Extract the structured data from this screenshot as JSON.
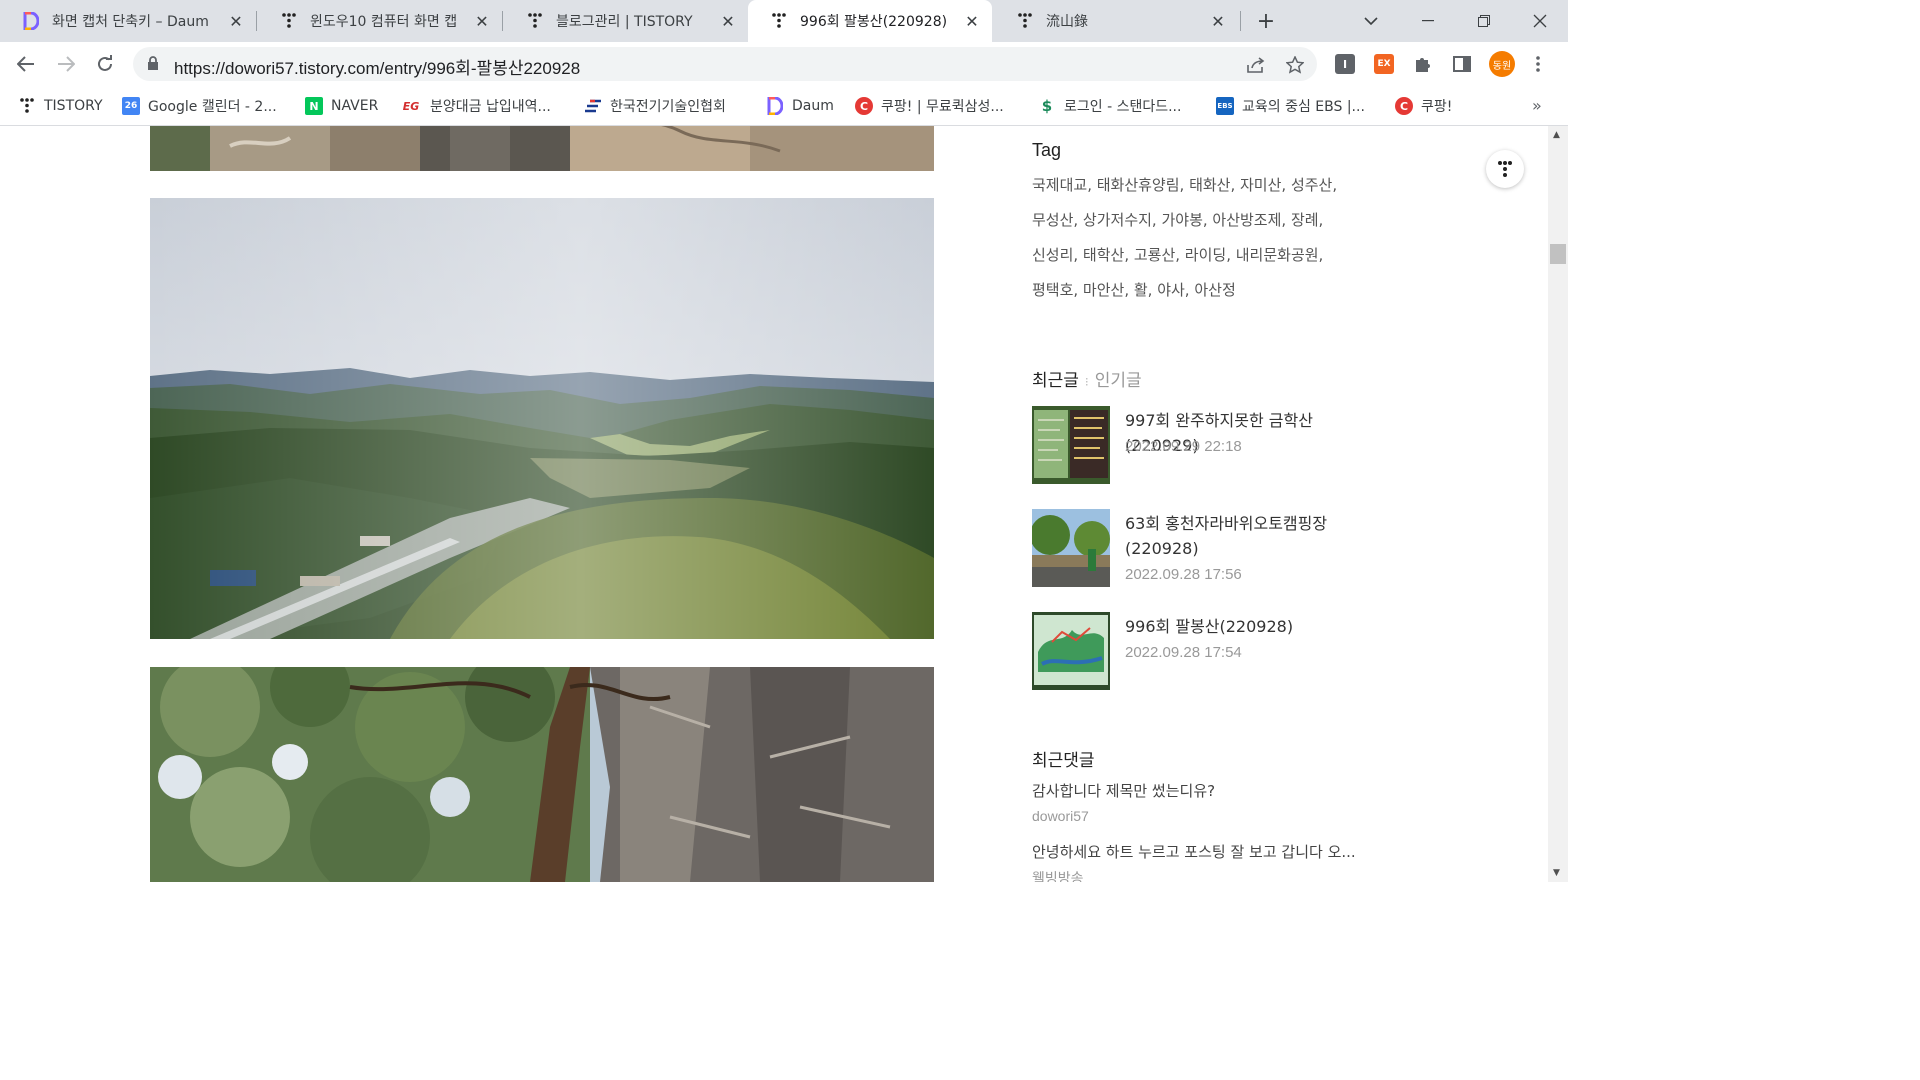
{
  "browser": {
    "tabs": [
      {
        "title": "화면 캡처 단축키 – Daum",
        "icon": "daum-icon",
        "active": false
      },
      {
        "title": "윈도우10 컴퓨터 화면 캡",
        "icon": "tistory-icon",
        "active": false
      },
      {
        "title": "블로그관리 | TISTORY",
        "icon": "tistory-icon",
        "active": false
      },
      {
        "title": "996회 팔봉산(220928)",
        "icon": "tistory-icon",
        "active": true
      },
      {
        "title": "流山錄",
        "icon": "tistory-icon",
        "active": false
      }
    ],
    "url": "https://dowori57.tistory.com/entry/996회-팔봉산220928",
    "profile_label": "동원",
    "extensions": [
      {
        "label": "I",
        "color": "#5f6368"
      },
      {
        "label": "EX",
        "color": "#f26522"
      }
    ],
    "bookmarks": [
      {
        "label": "TISTORY",
        "icon": "tistory-icon",
        "color": "#202124"
      },
      {
        "label": "Google 캘린더 - 2...",
        "icon": "calendar-icon",
        "color": "#4285f4"
      },
      {
        "label": "NAVER",
        "icon": "naver-icon",
        "color": "#03c75a"
      },
      {
        "label": "분양대금 납입내역...",
        "icon": "eg-icon",
        "color": "#d32f2f"
      },
      {
        "label": "한국전기기술인협회",
        "icon": "kea-icon",
        "color": "#1a3a8f"
      },
      {
        "label": "Daum",
        "icon": "daum-icon",
        "color": "#7b61ff"
      },
      {
        "label": "쿠팡! | 무료퀵삼성...",
        "icon": "coupang-icon",
        "color": "#e53935"
      },
      {
        "label": "로그인 - 스탠다드...",
        "icon": "standard-icon",
        "color": "#1b8a5a"
      },
      {
        "label": "교육의 중심 EBS |...",
        "icon": "ebs-icon",
        "color": "#1565c0"
      },
      {
        "label": "쿠팡!",
        "icon": "coupang-icon",
        "color": "#e53935"
      }
    ]
  },
  "sidebar": {
    "tag_title": "Tag",
    "tag_lines": [
      "국제대교,  태화산휴양림,  태화산,  자미산,  성주산,",
      "무성산,  상가저수지,  가야봉,  아산방조제,  장례,",
      "신성리,  태학산,  고룡산,  라이딩,  내리문화공원,",
      "평택호,  마안산,  활,  야사,  아산정"
    ],
    "recent_tab": "최근글",
    "popular_tab": "인기글",
    "posts": [
      {
        "title": "997회 완주하지못한 금학산(220929)",
        "date": "2022.09.29 22:18"
      },
      {
        "title": "63회 홍천자라바위오토캠핑장 (220928)",
        "date": "2022.09.28 17:56"
      },
      {
        "title": "996회 팔봉산(220928)",
        "date": "2022.09.28 17:54"
      }
    ],
    "comments_title": "최근댓글",
    "comments": [
      {
        "text": "감사합니다 제목만 썼는디유?",
        "author": "dowori57"
      },
      {
        "text": "안녕하세요 하트 누르고 포스팅 잘 보고 갑니다 오...",
        "author": "웰빙방송"
      }
    ]
  }
}
